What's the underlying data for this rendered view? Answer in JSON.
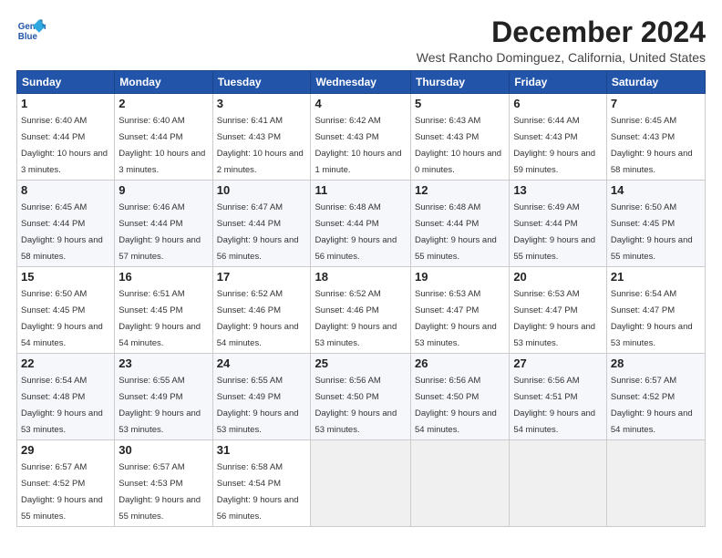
{
  "logo": {
    "line1": "General",
    "line2": "Blue"
  },
  "title": "December 2024",
  "subtitle": "West Rancho Dominguez, California, United States",
  "days_of_week": [
    "Sunday",
    "Monday",
    "Tuesday",
    "Wednesday",
    "Thursday",
    "Friday",
    "Saturday"
  ],
  "weeks": [
    [
      {
        "day": "1",
        "sunrise": "6:40 AM",
        "sunset": "4:44 PM",
        "daylight": "10 hours and 3 minutes."
      },
      {
        "day": "2",
        "sunrise": "6:40 AM",
        "sunset": "4:44 PM",
        "daylight": "10 hours and 3 minutes."
      },
      {
        "day": "3",
        "sunrise": "6:41 AM",
        "sunset": "4:43 PM",
        "daylight": "10 hours and 2 minutes."
      },
      {
        "day": "4",
        "sunrise": "6:42 AM",
        "sunset": "4:43 PM",
        "daylight": "10 hours and 1 minute."
      },
      {
        "day": "5",
        "sunrise": "6:43 AM",
        "sunset": "4:43 PM",
        "daylight": "10 hours and 0 minutes."
      },
      {
        "day": "6",
        "sunrise": "6:44 AM",
        "sunset": "4:43 PM",
        "daylight": "9 hours and 59 minutes."
      },
      {
        "day": "7",
        "sunrise": "6:45 AM",
        "sunset": "4:43 PM",
        "daylight": "9 hours and 58 minutes."
      }
    ],
    [
      {
        "day": "8",
        "sunrise": "6:45 AM",
        "sunset": "4:44 PM",
        "daylight": "9 hours and 58 minutes."
      },
      {
        "day": "9",
        "sunrise": "6:46 AM",
        "sunset": "4:44 PM",
        "daylight": "9 hours and 57 minutes."
      },
      {
        "day": "10",
        "sunrise": "6:47 AM",
        "sunset": "4:44 PM",
        "daylight": "9 hours and 56 minutes."
      },
      {
        "day": "11",
        "sunrise": "6:48 AM",
        "sunset": "4:44 PM",
        "daylight": "9 hours and 56 minutes."
      },
      {
        "day": "12",
        "sunrise": "6:48 AM",
        "sunset": "4:44 PM",
        "daylight": "9 hours and 55 minutes."
      },
      {
        "day": "13",
        "sunrise": "6:49 AM",
        "sunset": "4:44 PM",
        "daylight": "9 hours and 55 minutes."
      },
      {
        "day": "14",
        "sunrise": "6:50 AM",
        "sunset": "4:45 PM",
        "daylight": "9 hours and 55 minutes."
      }
    ],
    [
      {
        "day": "15",
        "sunrise": "6:50 AM",
        "sunset": "4:45 PM",
        "daylight": "9 hours and 54 minutes."
      },
      {
        "day": "16",
        "sunrise": "6:51 AM",
        "sunset": "4:45 PM",
        "daylight": "9 hours and 54 minutes."
      },
      {
        "day": "17",
        "sunrise": "6:52 AM",
        "sunset": "4:46 PM",
        "daylight": "9 hours and 54 minutes."
      },
      {
        "day": "18",
        "sunrise": "6:52 AM",
        "sunset": "4:46 PM",
        "daylight": "9 hours and 53 minutes."
      },
      {
        "day": "19",
        "sunrise": "6:53 AM",
        "sunset": "4:47 PM",
        "daylight": "9 hours and 53 minutes."
      },
      {
        "day": "20",
        "sunrise": "6:53 AM",
        "sunset": "4:47 PM",
        "daylight": "9 hours and 53 minutes."
      },
      {
        "day": "21",
        "sunrise": "6:54 AM",
        "sunset": "4:47 PM",
        "daylight": "9 hours and 53 minutes."
      }
    ],
    [
      {
        "day": "22",
        "sunrise": "6:54 AM",
        "sunset": "4:48 PM",
        "daylight": "9 hours and 53 minutes."
      },
      {
        "day": "23",
        "sunrise": "6:55 AM",
        "sunset": "4:49 PM",
        "daylight": "9 hours and 53 minutes."
      },
      {
        "day": "24",
        "sunrise": "6:55 AM",
        "sunset": "4:49 PM",
        "daylight": "9 hours and 53 minutes."
      },
      {
        "day": "25",
        "sunrise": "6:56 AM",
        "sunset": "4:50 PM",
        "daylight": "9 hours and 53 minutes."
      },
      {
        "day": "26",
        "sunrise": "6:56 AM",
        "sunset": "4:50 PM",
        "daylight": "9 hours and 54 minutes."
      },
      {
        "day": "27",
        "sunrise": "6:56 AM",
        "sunset": "4:51 PM",
        "daylight": "9 hours and 54 minutes."
      },
      {
        "day": "28",
        "sunrise": "6:57 AM",
        "sunset": "4:52 PM",
        "daylight": "9 hours and 54 minutes."
      }
    ],
    [
      {
        "day": "29",
        "sunrise": "6:57 AM",
        "sunset": "4:52 PM",
        "daylight": "9 hours and 55 minutes."
      },
      {
        "day": "30",
        "sunrise": "6:57 AM",
        "sunset": "4:53 PM",
        "daylight": "9 hours and 55 minutes."
      },
      {
        "day": "31",
        "sunrise": "6:58 AM",
        "sunset": "4:54 PM",
        "daylight": "9 hours and 56 minutes."
      },
      null,
      null,
      null,
      null
    ]
  ]
}
